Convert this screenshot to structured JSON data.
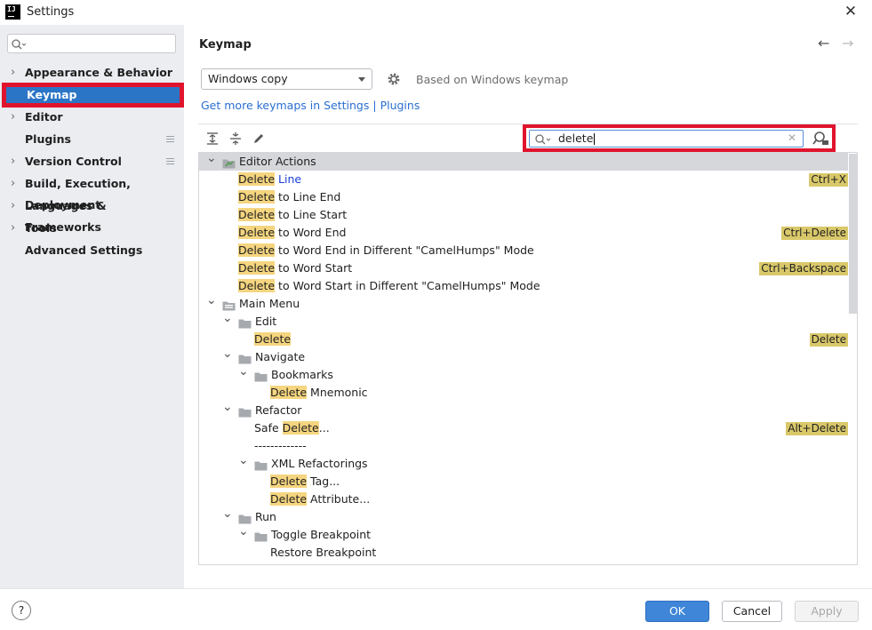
{
  "window": {
    "title": "Settings",
    "app_icon_text": "IJ"
  },
  "sidebar": {
    "search_placeholder": "",
    "items": [
      {
        "label": "Appearance & Behavior",
        "expandable": true
      },
      {
        "label": "Keymap",
        "expandable": false,
        "selected": true
      },
      {
        "label": "Editor",
        "expandable": true
      },
      {
        "label": "Plugins",
        "expandable": false
      },
      {
        "label": "Version Control",
        "expandable": true
      },
      {
        "label": "Build, Execution, Deployment",
        "expandable": true
      },
      {
        "label": "Languages & Frameworks",
        "expandable": true
      },
      {
        "label": "Tools",
        "expandable": true
      },
      {
        "label": "Advanced Settings",
        "expandable": false
      }
    ]
  },
  "main": {
    "title": "Keymap",
    "keymap_select": "Windows copy",
    "based_on": "Based on Windows keymap",
    "link_text": "Get more keymaps in Settings",
    "link_separator": " | ",
    "link_plugins": "Plugins",
    "search_value": "delete"
  },
  "tree": {
    "rows": [
      {
        "level": 0,
        "toggle": "open",
        "icon": "action-folder",
        "header": true,
        "pre": "",
        "hl": "",
        "post": "Editor Actions",
        "shortcut": ""
      },
      {
        "level": 2,
        "toggle": "",
        "icon": "",
        "pre": "",
        "hl": "Delete",
        "post": " Line",
        "blue": true,
        "shortcut": "Ctrl+X"
      },
      {
        "level": 2,
        "toggle": "",
        "icon": "",
        "pre": "",
        "hl": "Delete",
        "post": " to Line End",
        "shortcut": ""
      },
      {
        "level": 2,
        "toggle": "",
        "icon": "",
        "pre": "",
        "hl": "Delete",
        "post": " to Line Start",
        "shortcut": ""
      },
      {
        "level": 2,
        "toggle": "",
        "icon": "",
        "pre": "",
        "hl": "Delete",
        "post": " to Word End",
        "shortcut": "Ctrl+Delete"
      },
      {
        "level": 2,
        "toggle": "",
        "icon": "",
        "pre": "",
        "hl": "Delete",
        "post": " to Word End in Different \"CamelHumps\" Mode",
        "shortcut": ""
      },
      {
        "level": 2,
        "toggle": "",
        "icon": "",
        "pre": "",
        "hl": "Delete",
        "post": " to Word Start",
        "shortcut": "Ctrl+Backspace"
      },
      {
        "level": 2,
        "toggle": "",
        "icon": "",
        "pre": "",
        "hl": "Delete",
        "post": " to Word Start in Different \"CamelHumps\" Mode",
        "shortcut": ""
      },
      {
        "level": 0,
        "toggle": "open",
        "icon": "menu-folder",
        "pre": "",
        "hl": "",
        "post": "Main Menu",
        "shortcut": ""
      },
      {
        "level": 1,
        "toggle": "open",
        "icon": "folder",
        "pre": "",
        "hl": "",
        "post": "Edit",
        "shortcut": ""
      },
      {
        "level": 3,
        "toggle": "",
        "icon": "",
        "pre": "",
        "hl": "Delete",
        "post": "",
        "shortcut": "Delete"
      },
      {
        "level": 1,
        "toggle": "open",
        "icon": "folder",
        "pre": "",
        "hl": "",
        "post": "Navigate",
        "shortcut": ""
      },
      {
        "level": 2,
        "toggle": "open",
        "icon": "folder",
        "pre": "",
        "hl": "",
        "post": "Bookmarks",
        "shortcut": ""
      },
      {
        "level": 4,
        "toggle": "",
        "icon": "",
        "pre": "",
        "hl": "Delete",
        "post": " Mnemonic",
        "shortcut": ""
      },
      {
        "level": 1,
        "toggle": "open",
        "icon": "folder",
        "pre": "",
        "hl": "",
        "post": "Refactor",
        "shortcut": ""
      },
      {
        "level": 3,
        "toggle": "",
        "icon": "",
        "pre": "Safe ",
        "hl": "Delete",
        "post": "...",
        "shortcut": "Alt+Delete"
      },
      {
        "level": 3,
        "toggle": "",
        "icon": "",
        "pre": "",
        "hl": "",
        "post": "-------------",
        "shortcut": ""
      },
      {
        "level": 2,
        "toggle": "open",
        "icon": "folder",
        "pre": "",
        "hl": "",
        "post": "XML Refactorings",
        "shortcut": ""
      },
      {
        "level": 4,
        "toggle": "",
        "icon": "",
        "pre": "",
        "hl": "Delete",
        "post": " Tag...",
        "shortcut": ""
      },
      {
        "level": 4,
        "toggle": "",
        "icon": "",
        "pre": "",
        "hl": "Delete",
        "post": " Attribute...",
        "shortcut": ""
      },
      {
        "level": 1,
        "toggle": "open",
        "icon": "folder",
        "pre": "",
        "hl": "",
        "post": "Run",
        "shortcut": ""
      },
      {
        "level": 2,
        "toggle": "open",
        "icon": "folder",
        "pre": "",
        "hl": "",
        "post": "Toggle Breakpoint",
        "shortcut": ""
      },
      {
        "level": 4,
        "toggle": "",
        "icon": "",
        "pre": "",
        "hl": "",
        "post": "Restore Breakpoint",
        "shortcut": ""
      }
    ]
  },
  "buttons": {
    "help": "?",
    "ok": "OK",
    "cancel": "Cancel",
    "apply": "Apply"
  },
  "colors": {
    "accent": "#2b75c6",
    "highlight": "#f5d57f",
    "shortcut_bg": "#d9c86a",
    "annotation_red": "#e0142d"
  }
}
